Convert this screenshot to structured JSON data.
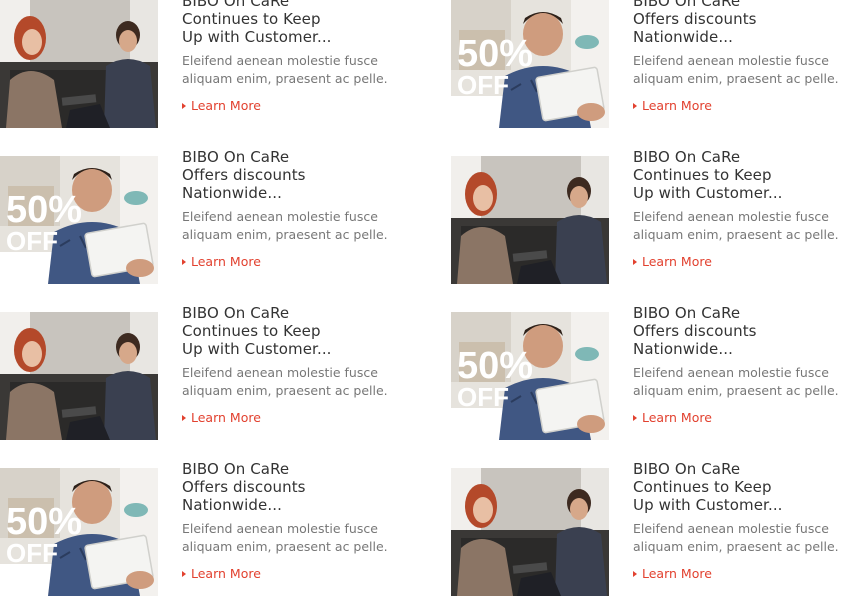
{
  "articles": [
    {
      "image": "couple-with-tablet",
      "title": [
        "BIBO On CaRe",
        "Continues to Keep",
        "Up with Customer..."
      ],
      "desc": [
        "Eleifend aenean molestie fusce",
        "aliquam enim, praesent ac pelle."
      ],
      "link": "Learn More"
    },
    {
      "image": "man-with-tablet-50-off",
      "title": [
        "BIBO On CaRe",
        "Offers discounts",
        "Nationwide..."
      ],
      "desc": [
        "Eleifend aenean molestie fusce",
        "aliquam enim, praesent ac pelle."
      ],
      "link": "Learn More",
      "badge": [
        "50%",
        "OFF"
      ]
    },
    {
      "image": "man-with-tablet-50-off",
      "title": [
        "BIBO On CaRe",
        "Offers discounts",
        "Nationwide..."
      ],
      "desc": [
        "Eleifend aenean molestie fusce",
        "aliquam enim, praesent ac pelle."
      ],
      "link": "Learn More",
      "badge": [
        "50%",
        "OFF"
      ]
    },
    {
      "image": "couple-with-tablet",
      "title": [
        "BIBO On CaRe",
        "Continues to Keep",
        "Up with Customer..."
      ],
      "desc": [
        "Eleifend aenean molestie fusce",
        "aliquam enim, praesent ac pelle."
      ],
      "link": "Learn More"
    },
    {
      "image": "couple-with-tablet",
      "title": [
        "BIBO On CaRe",
        "Continues to Keep",
        "Up with Customer..."
      ],
      "desc": [
        "Eleifend aenean molestie fusce",
        "aliquam enim, praesent ac pelle."
      ],
      "link": "Learn More"
    },
    {
      "image": "man-with-tablet-50-off",
      "title": [
        "BIBO On CaRe",
        "Offers discounts",
        "Nationwide..."
      ],
      "desc": [
        "Eleifend aenean molestie fusce",
        "aliquam enim, praesent ac pelle."
      ],
      "link": "Learn More",
      "badge": [
        "50%",
        "OFF"
      ]
    },
    {
      "image": "man-with-tablet-50-off",
      "title": [
        "BIBO On CaRe",
        "Offers discounts",
        "Nationwide..."
      ],
      "desc": [
        "Eleifend aenean molestie fusce",
        "aliquam enim, praesent ac pelle."
      ],
      "link": "Learn More",
      "badge": [
        "50%",
        "OFF"
      ]
    },
    {
      "image": "couple-with-tablet",
      "title": [
        "BIBO On CaRe",
        "Continues to Keep",
        "Up with Customer..."
      ],
      "desc": [
        "Eleifend aenean molestie fusce",
        "aliquam enim, praesent ac pelle."
      ],
      "link": "Learn More"
    }
  ],
  "colors": {
    "link": "#e2412f",
    "title": "#333333",
    "desc": "#777777"
  }
}
